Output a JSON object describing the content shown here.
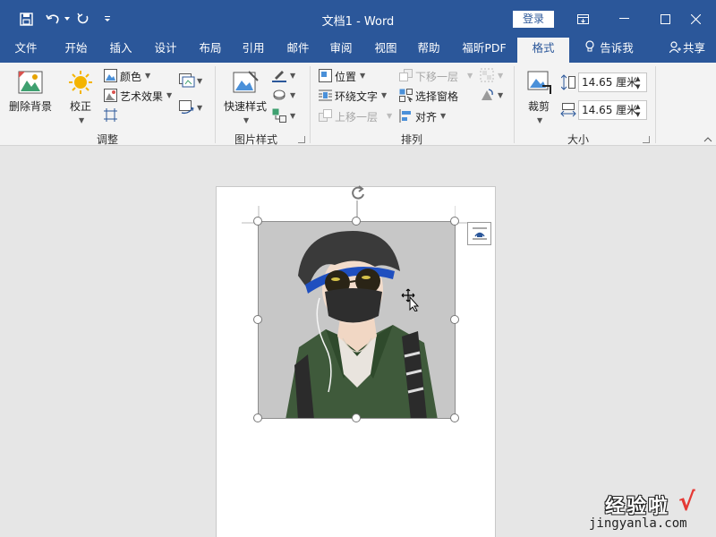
{
  "window": {
    "title": "文档1  -  Word",
    "login_label": "登录"
  },
  "tabs": [
    {
      "label": "文件"
    },
    {
      "label": "开始"
    },
    {
      "label": "插入"
    },
    {
      "label": "设计"
    },
    {
      "label": "布局"
    },
    {
      "label": "引用"
    },
    {
      "label": "邮件"
    },
    {
      "label": "审阅"
    },
    {
      "label": "视图"
    },
    {
      "label": "帮助"
    },
    {
      "label": "福昕PDF"
    },
    {
      "label": "格式",
      "active": true
    }
  ],
  "tell_me": "告诉我",
  "share": "共享",
  "ribbon": {
    "adjust": {
      "title": "调整",
      "remove_bg": "删除背景",
      "correct": "校正",
      "color": "颜色",
      "artistic": "艺术效果"
    },
    "styles": {
      "title": "图片样式",
      "quick": "快速样式"
    },
    "arrange": {
      "title": "排列",
      "position": "位置",
      "wrap": "环绕文字",
      "bring_forward": "上移一层",
      "send_backward": "下移一层",
      "selection_pane": "选择窗格",
      "align": "对齐"
    },
    "size": {
      "title": "大小",
      "crop": "裁剪",
      "height": "14.65 厘米",
      "width": "14.65 厘米"
    }
  },
  "watermark": {
    "line1": "经验啦",
    "line2": "jingyanla.com",
    "check": "√"
  },
  "colors": {
    "brand": "#2b579a",
    "ribbon_bg": "#f3f3f3",
    "doc_bg": "#e6e6e6",
    "jacket": "#3f5a3b",
    "hair": "#3a3a3a",
    "headband": "#1f4fbf"
  }
}
